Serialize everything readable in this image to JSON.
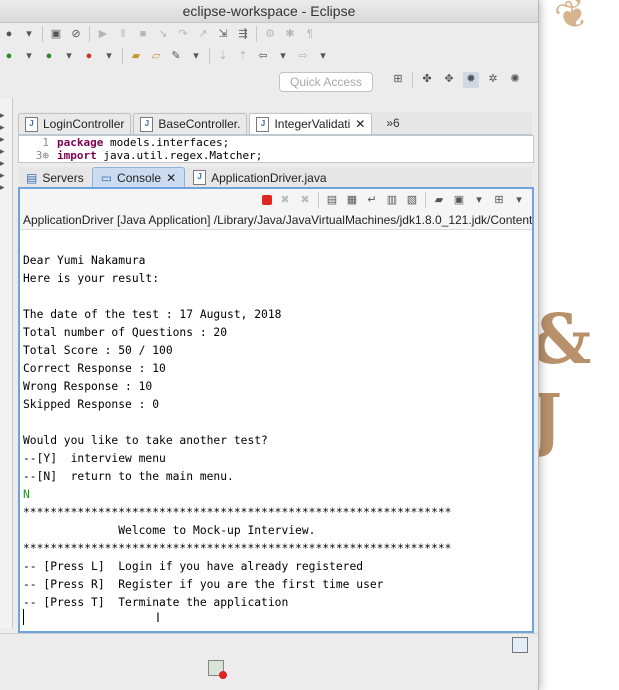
{
  "window": {
    "title": "eclipse-workspace - Eclipse"
  },
  "quick_access": {
    "placeholder": "Quick Access"
  },
  "editor": {
    "tabs": [
      {
        "label": "LoginController"
      },
      {
        "label": "BaseController."
      },
      {
        "label": "IntegerValidati",
        "active": true
      }
    ],
    "overflow_label": "»6",
    "code": [
      {
        "line": "1",
        "keyword": "package",
        "text": " models.interfaces;"
      },
      {
        "line": "3⊕",
        "keyword": "import",
        "text": " java.util.regex.Matcher;"
      }
    ]
  },
  "views": {
    "tabs": [
      {
        "label": "Servers"
      },
      {
        "label": "Console",
        "active": true
      },
      {
        "label": "ApplicationDriver.java"
      }
    ]
  },
  "console": {
    "header": "ApplicationDriver [Java Application] /Library/Java/JavaVirtualMachines/jdk1.8.0_121.jdk/Content",
    "lines": [
      "",
      "Dear Yumi Nakamura",
      "Here is your result:",
      "",
      "The date of the test : 17 August, 2018",
      "Total number of Questions : 20",
      "Total Score : 50 / 100",
      "Correct Response : 10",
      "Wrong Response : 10",
      "Skipped Response : 0",
      "",
      "Would you like to take another test?",
      "--[Y]  interview menu",
      "--[N]  return to the main menu.",
      "N",
      "***************************************************************",
      "              Welcome to Mock-up Interview.",
      "***************************************************************",
      "-- [Press L]  Login if you have already registered",
      "-- [Press R]  Register if you are the first time user",
      "-- [Press T]  Terminate the application"
    ]
  },
  "colors": {
    "input_text": "#1a9a1a",
    "active_border": "#6ea3de",
    "terminate": "#e0271f"
  }
}
